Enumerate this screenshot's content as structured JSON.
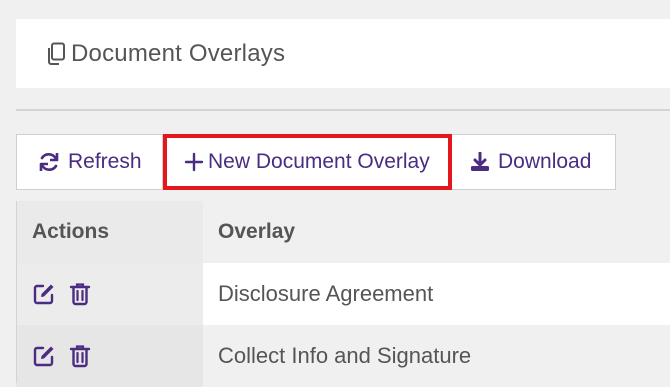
{
  "header": {
    "title": "Document Overlays",
    "icon": "copy-icon"
  },
  "toolbar": {
    "refresh_label": "Refresh",
    "new_label": "New Document Overlay",
    "download_label": "Download"
  },
  "table": {
    "columns": [
      "Actions",
      "Overlay"
    ],
    "rows": [
      {
        "overlay": "Disclosure Agreement"
      },
      {
        "overlay": "Collect Info and Signature"
      }
    ]
  },
  "colors": {
    "accent": "#4a2c82",
    "highlight_border": "#e4181c",
    "text": "#555555"
  }
}
